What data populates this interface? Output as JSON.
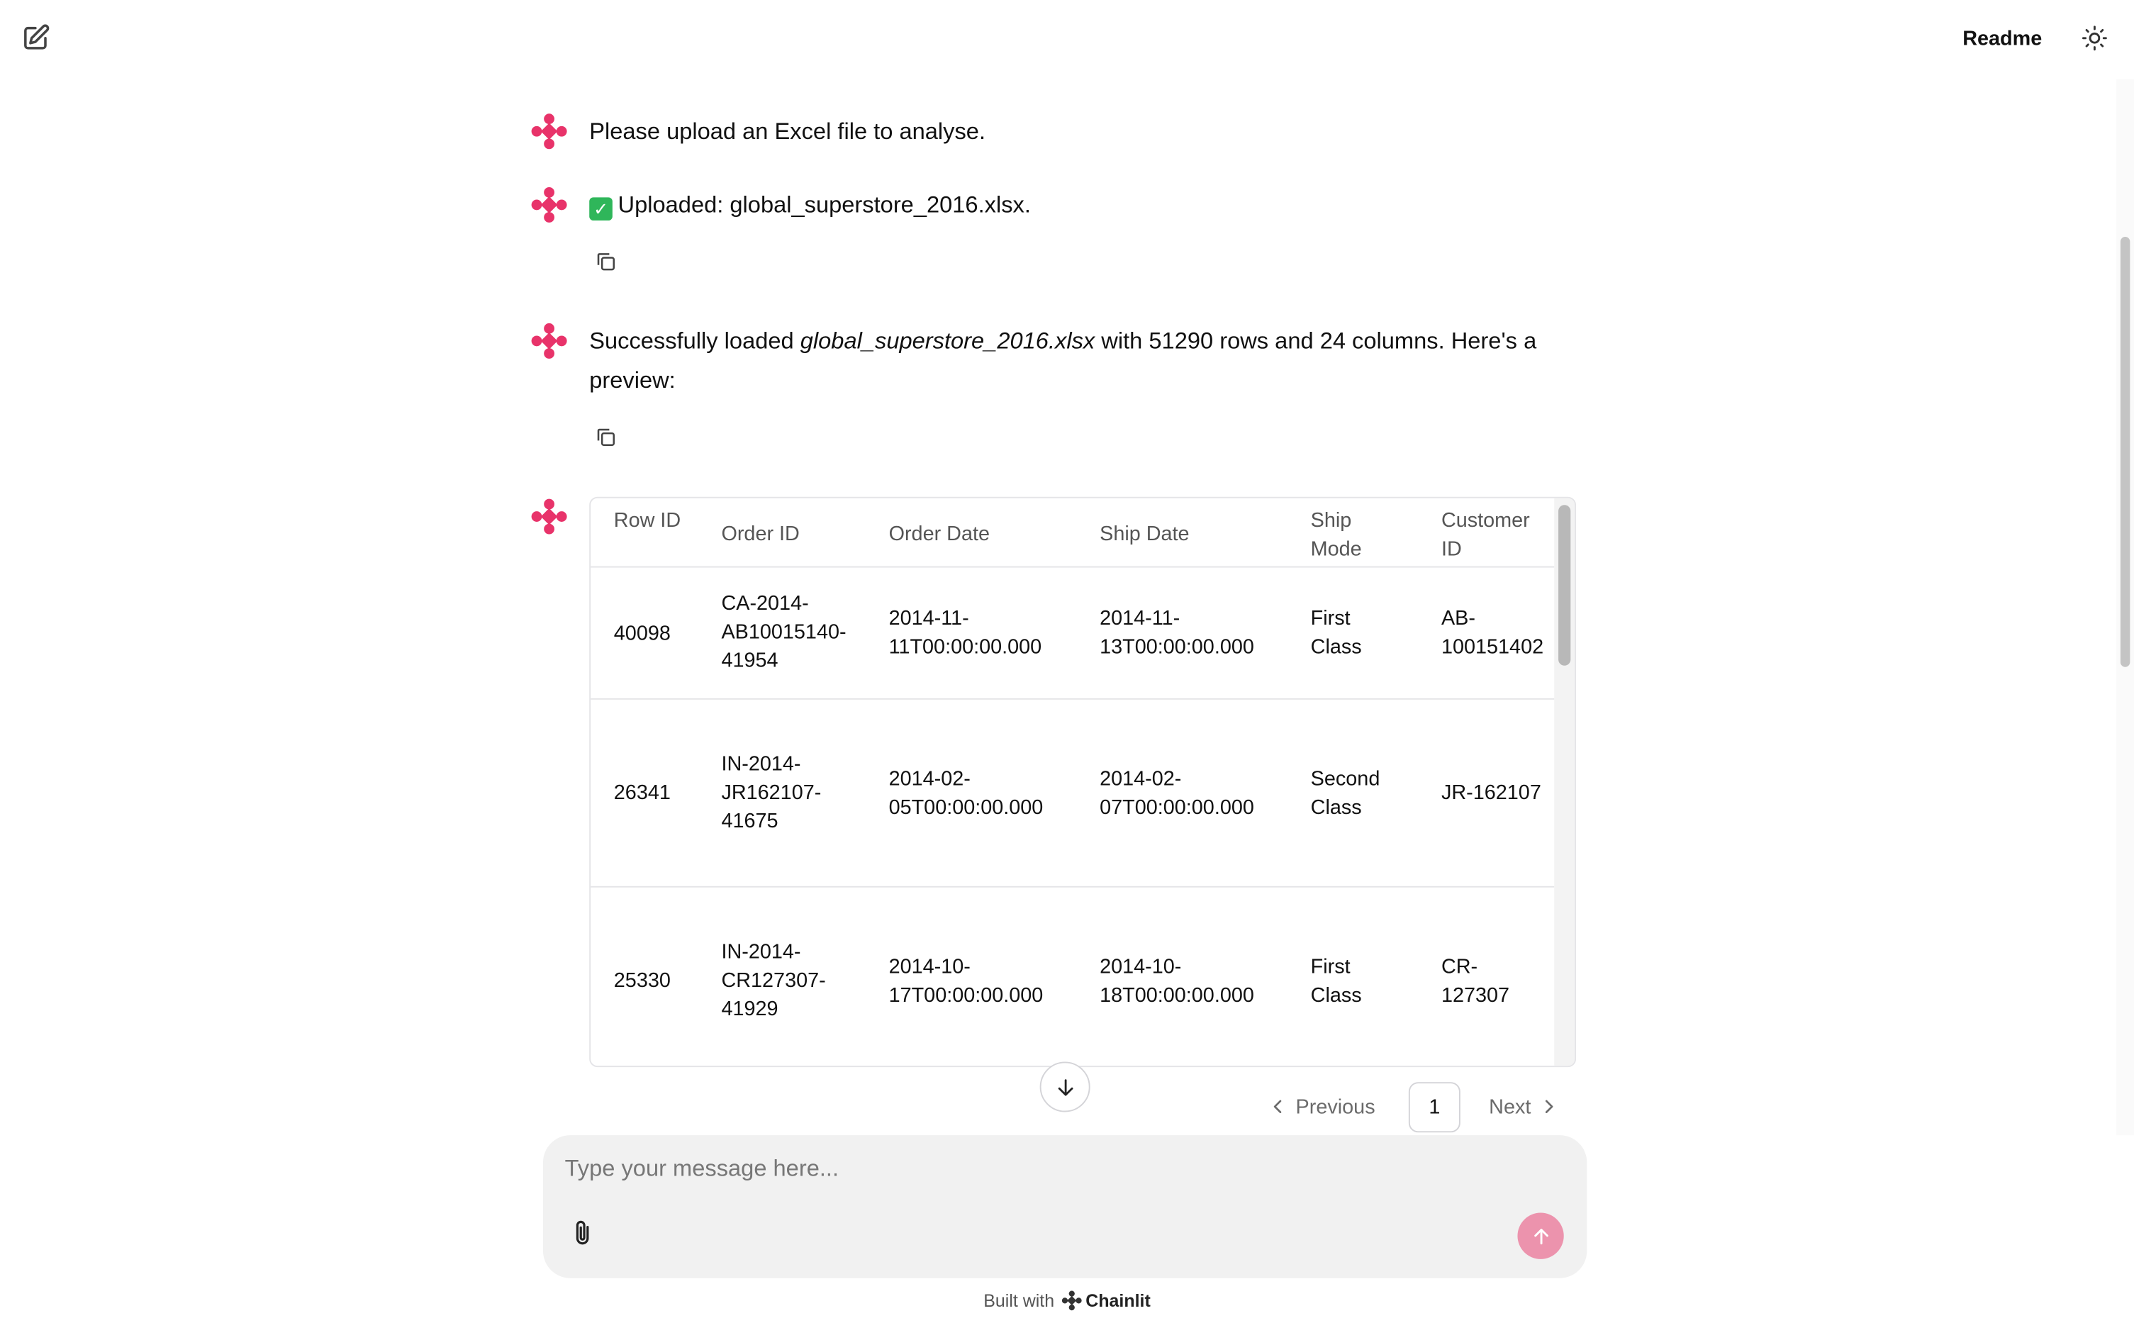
{
  "header": {
    "readme_label": "Readme",
    "icons": {
      "new_chat": "edit-square-icon",
      "theme": "sun-icon"
    }
  },
  "messages": [
    {
      "text": "Please upload an Excel file to analyse."
    },
    {
      "emoji": "✓",
      "text": "Uploaded: global_superstore_2016.xlsx."
    },
    {
      "text_before": "Successfully loaded ",
      "filename": "global_superstore_2016.xlsx",
      "text_after": " with 51290 rows and 24 columns. Here's a preview:"
    }
  ],
  "table": {
    "headers": [
      "Row ID",
      "Order ID",
      "Order Date",
      "Ship Date",
      "Ship Mode",
      "Customer ID"
    ],
    "rows": [
      [
        "40098",
        "CA-2014-AB10015140-41954",
        "2014-11-11T00:00:00.000",
        "2014-11-13T00:00:00.000",
        "First Class",
        "AB-100151402"
      ],
      [
        "26341",
        "IN-2014-JR162107-41675",
        "2014-02-05T00:00:00.000",
        "2014-02-07T00:00:00.000",
        "Second Class",
        "JR-162107"
      ],
      [
        "25330",
        "IN-2014-CR127307-41929",
        "2014-10-17T00:00:00.000",
        "2014-10-18T00:00:00.000",
        "First Class",
        "CR-127307"
      ]
    ]
  },
  "pagination": {
    "previous_label": "Previous",
    "current_page": "1",
    "next_label": "Next"
  },
  "composer": {
    "placeholder": "Type your message here..."
  },
  "footer": {
    "built_with": "Built with",
    "brand": "Chainlit"
  },
  "colors": {
    "brand_pink": "#e8336a",
    "send_button": "#ec93ad",
    "composer_bg": "#f1f1f1",
    "border": "#e4e4e7"
  }
}
